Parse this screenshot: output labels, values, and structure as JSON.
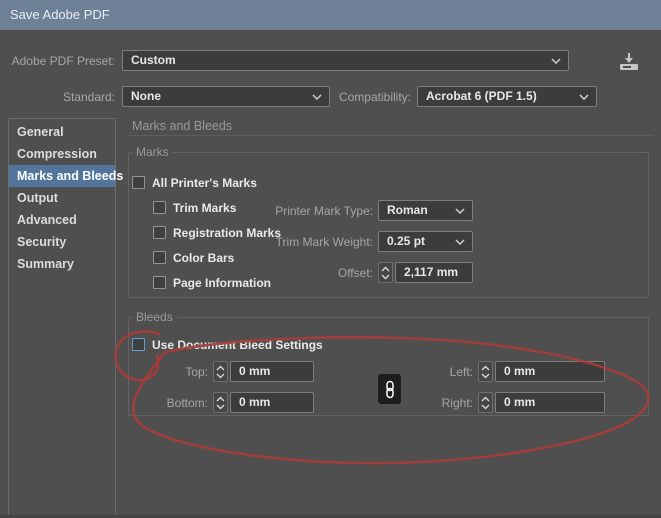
{
  "titlebar": {
    "title": "Save Adobe PDF"
  },
  "header": {
    "preset_label": "Adobe PDF Preset:",
    "preset_value": "Custom",
    "standard_label": "Standard:",
    "standard_value": "None",
    "compatibility_label": "Compatibility:",
    "compatibility_value": "Acrobat 6 (PDF 1.5)"
  },
  "sidebar": {
    "items": [
      {
        "label": "General",
        "selected": false
      },
      {
        "label": "Compression",
        "selected": false
      },
      {
        "label": "Marks and Bleeds",
        "selected": true
      },
      {
        "label": "Output",
        "selected": false
      },
      {
        "label": "Advanced",
        "selected": false
      },
      {
        "label": "Security",
        "selected": false
      },
      {
        "label": "Summary",
        "selected": false
      }
    ]
  },
  "panel": {
    "heading": "Marks and Bleeds",
    "marks": {
      "group_label": "Marks",
      "checkboxes": [
        {
          "label": "All Printer's Marks",
          "checked": false
        },
        {
          "label": "Trim Marks",
          "checked": false
        },
        {
          "label": "Registration Marks",
          "checked": false
        },
        {
          "label": "Color Bars",
          "checked": false
        },
        {
          "label": "Page Information",
          "checked": false
        }
      ],
      "printer_mark_type_label": "Printer Mark Type:",
      "printer_mark_type_value": "Roman",
      "trim_mark_weight_label": "Trim Mark Weight:",
      "trim_mark_weight_value": "0.25 pt",
      "offset_label": "Offset:",
      "offset_value": "2,117 mm"
    },
    "bleeds": {
      "group_label": "Bleeds",
      "use_document_checkbox_label": "Use Document Bleed Settings",
      "use_document_checked": false,
      "top_label": "Top:",
      "top_value": "0 mm",
      "bottom_label": "Bottom:",
      "bottom_value": "0 mm",
      "left_label": "Left:",
      "left_value": "0 mm",
      "right_label": "Right:",
      "right_value": "0 mm"
    }
  },
  "icons": {
    "save_preset": "download-tray-icon",
    "link_bleeds": "chain-link-icon",
    "dropdown": "chevron-down-icon",
    "stepper": "up-down-chevrons-icon"
  },
  "annotation": {
    "type": "freehand-red-ellipse",
    "color": "#a63d38",
    "note_color_titlebar": "#6e8095",
    "selected_item_color": "#54759b",
    "highlight_checkbox_border": "#5ea0d8"
  }
}
